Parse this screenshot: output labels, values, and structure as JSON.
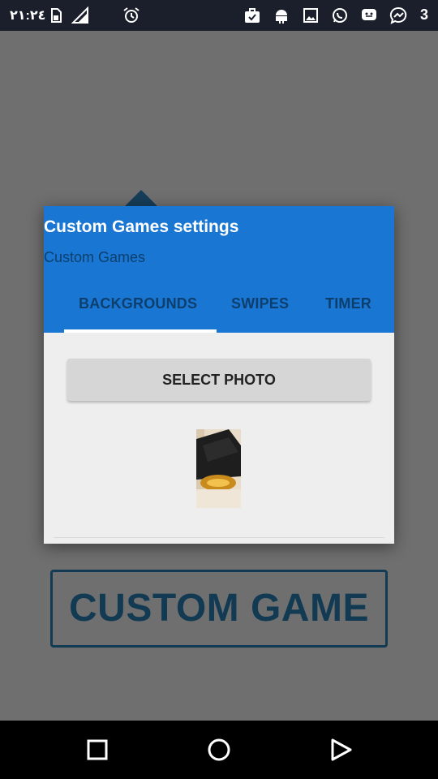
{
  "status_bar": {
    "time": "٢١:٢٤",
    "notification_count": "3",
    "icons": [
      "sim-card-icon",
      "signal-icon",
      "alarm-icon",
      "briefcase-check-icon",
      "android-icon",
      "image-icon",
      "whatsapp-icon",
      "chat-bubble-icon",
      "messenger-icon"
    ]
  },
  "background": {
    "custom_game_label": "CUSTOM GAME"
  },
  "dialog": {
    "title": "Custom Games settings",
    "subtitle": "Custom Games",
    "tabs": [
      {
        "label": "BACKGROUNDS",
        "selected": true
      },
      {
        "label": "SWIPES",
        "selected": false
      },
      {
        "label": "TIMER",
        "selected": false
      }
    ],
    "select_photo_label": "SELECT PHOTO"
  },
  "colors": {
    "header_blue": "#1976d2",
    "tab_text": "#0d3f6e",
    "status_bar": "#1b1f2b",
    "scrim": "#6f6f6f"
  },
  "nav_bar": {
    "buttons": [
      "recents-square-icon",
      "home-circle-icon",
      "back-triangle-icon"
    ]
  }
}
